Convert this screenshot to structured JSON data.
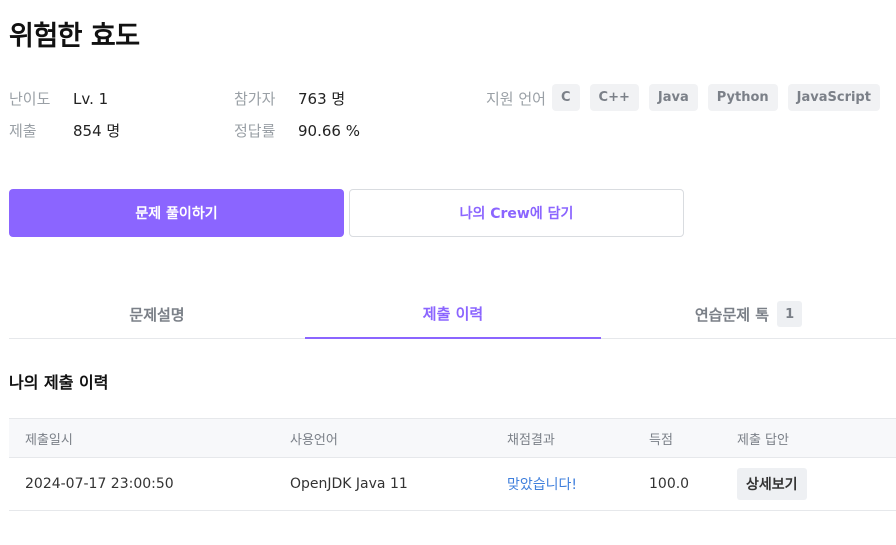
{
  "problem": {
    "title": "위험한 효도"
  },
  "meta": {
    "difficulty_label": "난이도",
    "difficulty_value": "Lv. 1",
    "participants_label": "참가자",
    "participants_value": "763 명",
    "submissions_label": "제출",
    "submissions_value": "854 명",
    "accuracy_label": "정답률",
    "accuracy_value": "90.66 %",
    "languages_label": "지원 언어",
    "languages": [
      "C",
      "C++",
      "Java",
      "Python",
      "JavaScript"
    ]
  },
  "actions": {
    "solve_label": "문제 풀이하기",
    "crew_label": "나의 Crew에 담기"
  },
  "tabs": [
    {
      "label": "문제설명",
      "active": false
    },
    {
      "label": "제출 이력",
      "active": true
    },
    {
      "label": "연습문제 톡",
      "active": false,
      "badge": "1"
    }
  ],
  "history": {
    "title": "나의 제출 이력",
    "columns": [
      "제출일시",
      "사용언어",
      "채점결과",
      "득점",
      "제출 답안"
    ],
    "rows": [
      {
        "datetime": "2024-07-17 23:00:50",
        "language": "OpenJDK Java 11",
        "result": "맞았습니다!",
        "score": "100.0",
        "action": "상세보기"
      }
    ]
  },
  "colors": {
    "accent": "#8b65ff",
    "result_link": "#3f7fdc",
    "muted": "#9aa0a6"
  }
}
